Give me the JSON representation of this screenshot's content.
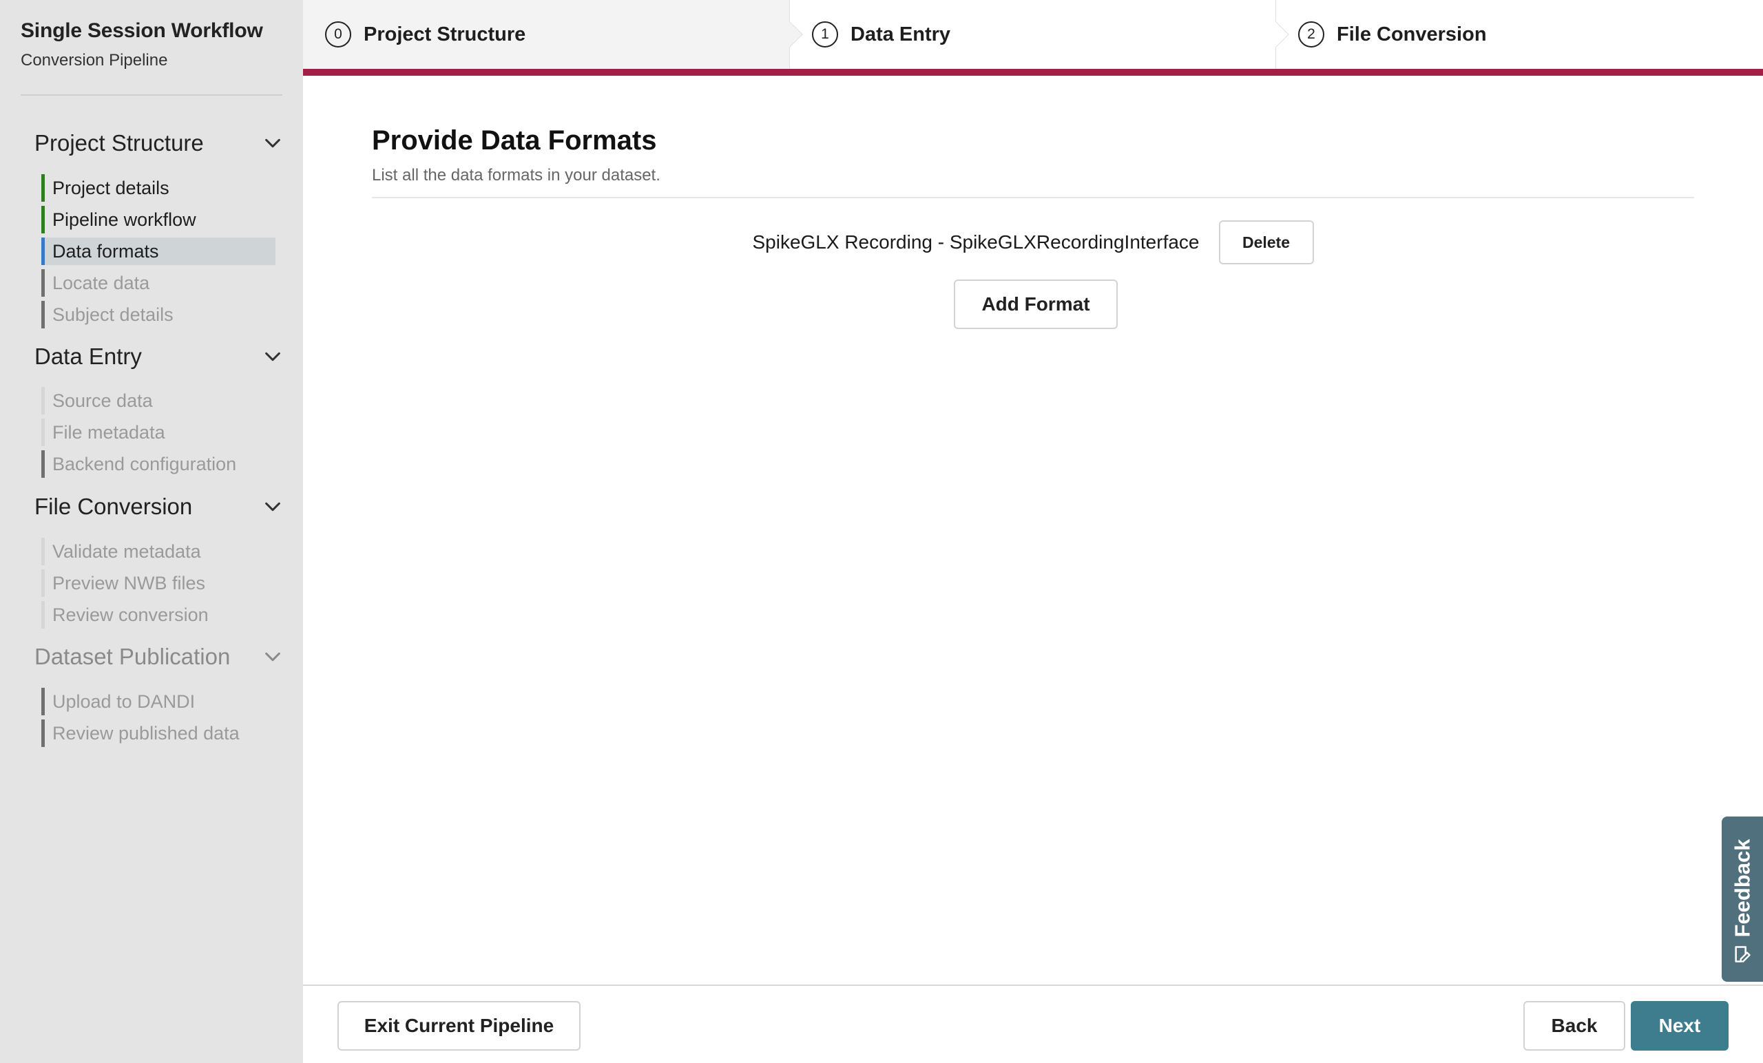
{
  "app": {
    "title": "Single Session Workflow",
    "subtitle": "Conversion Pipeline"
  },
  "sidebar": {
    "sections": [
      {
        "title": "Project Structure",
        "steps": [
          {
            "label": "Project details",
            "state": "done"
          },
          {
            "label": "Pipeline workflow",
            "state": "done"
          },
          {
            "label": "Data formats",
            "state": "active"
          },
          {
            "label": "Locate data",
            "state": "pending"
          },
          {
            "label": "Subject details",
            "state": "pending"
          }
        ]
      },
      {
        "title": "Data Entry",
        "steps": [
          {
            "label": "Source data",
            "state": "pending"
          },
          {
            "label": "File metadata",
            "state": "pending"
          },
          {
            "label": "Backend configuration",
            "state": "pending"
          }
        ]
      },
      {
        "title": "File Conversion",
        "steps": [
          {
            "label": "Validate metadata",
            "state": "pending"
          },
          {
            "label": "Preview NWB files",
            "state": "pending"
          },
          {
            "label": "Review conversion",
            "state": "pending"
          }
        ]
      },
      {
        "title": "Dataset Publication",
        "steps": [
          {
            "label": "Upload to DANDI",
            "state": "pending"
          },
          {
            "label": "Review published data",
            "state": "pending"
          }
        ]
      }
    ]
  },
  "stepper": {
    "tabs": [
      {
        "number": "0",
        "label": "Project Structure"
      },
      {
        "number": "1",
        "label": "Data Entry"
      },
      {
        "number": "2",
        "label": "File Conversion"
      }
    ],
    "accent_color": "#a31f47"
  },
  "main": {
    "title": "Provide Data Formats",
    "subtitle": "List all the data formats in your dataset.",
    "formats": [
      {
        "label": "SpikeGLX Recording - SpikeGLXRecordingInterface",
        "delete_label": "Delete"
      }
    ],
    "add_label": "Add Format"
  },
  "footer": {
    "exit_label": "Exit Current Pipeline",
    "back_label": "Back",
    "next_label": "Next",
    "next_color": "#3e7d8d"
  },
  "feedback": {
    "label": "Feedback",
    "icon": "edit-icon"
  }
}
